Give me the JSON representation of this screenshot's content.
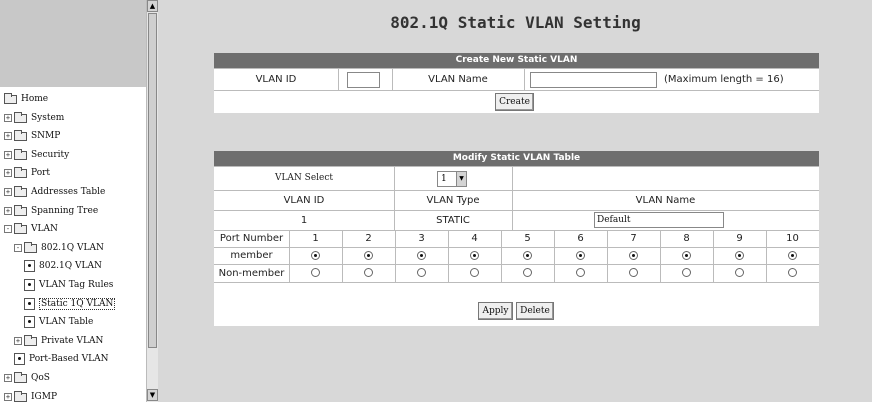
{
  "sidebar": {
    "items": [
      {
        "label": "Home",
        "kind": "folder",
        "expander": ""
      },
      {
        "label": "System",
        "kind": "folder",
        "expander": "+"
      },
      {
        "label": "SNMP",
        "kind": "folder",
        "expander": "+"
      },
      {
        "label": "Security",
        "kind": "folder",
        "expander": "+"
      },
      {
        "label": "Port",
        "kind": "folder",
        "expander": "+"
      },
      {
        "label": "Addresses Table",
        "kind": "folder",
        "expander": "+"
      },
      {
        "label": "Spanning Tree",
        "kind": "folder",
        "expander": "+"
      },
      {
        "label": "VLAN",
        "kind": "folder",
        "expander": "-"
      },
      {
        "label": "802.1Q VLAN",
        "kind": "folder",
        "expander": "-"
      },
      {
        "label": "802.1Q VLAN",
        "kind": "page",
        "expander": ""
      },
      {
        "label": "VLAN Tag Rules",
        "kind": "page",
        "expander": ""
      },
      {
        "label": "Static 1Q VLAN",
        "kind": "page",
        "expander": "",
        "selected": true
      },
      {
        "label": "VLAN Table",
        "kind": "page",
        "expander": ""
      },
      {
        "label": "Private VLAN",
        "kind": "folder",
        "expander": "+"
      },
      {
        "label": "Port-Based VLAN",
        "kind": "page",
        "expander": ""
      },
      {
        "label": "QoS",
        "kind": "folder",
        "expander": "+"
      },
      {
        "label": "IGMP",
        "kind": "folder",
        "expander": "+"
      }
    ],
    "scroll_up_icon": "▲",
    "scroll_down_icon": "▼"
  },
  "page": {
    "title": "802.1Q Static VLAN Setting"
  },
  "create": {
    "header": "Create New Static VLAN",
    "vlan_id_label": "VLAN ID",
    "vlan_id_value": "",
    "vlan_name_label": "VLAN Name",
    "vlan_name_value": "",
    "max_note": "(Maximum length = 16)",
    "create_button": "Create"
  },
  "modify": {
    "header": "Modify Static VLAN Table",
    "vlan_select_label": "VLAN Select",
    "vlan_select_value": "1",
    "col_vlan_id": "VLAN ID",
    "col_vlan_type": "VLAN Type",
    "col_vlan_name": "VLAN Name",
    "row_vlan_id": "1",
    "row_vlan_type": "STATIC",
    "row_vlan_name": "Default",
    "port_number_label": "Port Number",
    "member_label": "member",
    "nonmember_label": "Non-member",
    "ports": [
      "1",
      "2",
      "3",
      "4",
      "5",
      "6",
      "7",
      "8",
      "9",
      "10"
    ],
    "member_selected": [
      true,
      true,
      true,
      true,
      true,
      true,
      true,
      true,
      true,
      true
    ],
    "apply_button": "Apply",
    "delete_button": "Delete"
  }
}
